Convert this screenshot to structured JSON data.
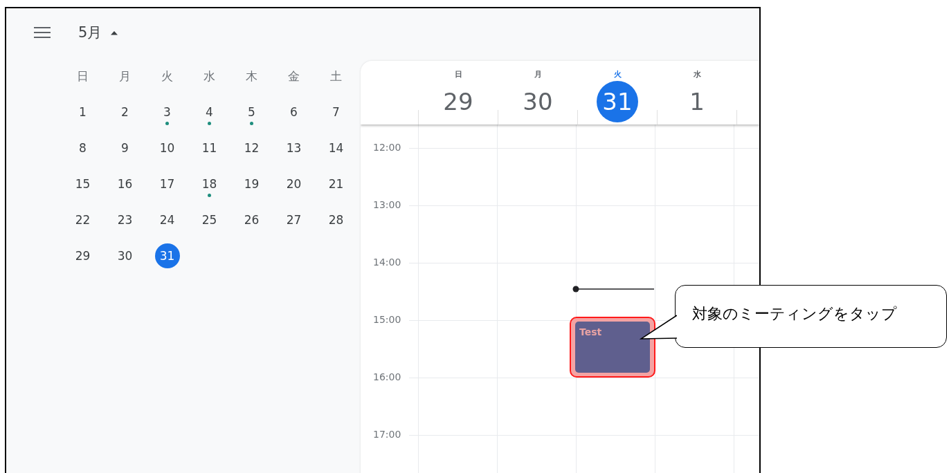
{
  "header": {
    "month": "5月"
  },
  "mini_calendar": {
    "weekdays": [
      "日",
      "月",
      "火",
      "水",
      "木",
      "金",
      "土"
    ],
    "weeks": [
      [
        {
          "day": "1",
          "dot": false,
          "selected": false
        },
        {
          "day": "2",
          "dot": false,
          "selected": false
        },
        {
          "day": "3",
          "dot": true,
          "selected": false
        },
        {
          "day": "4",
          "dot": true,
          "selected": false
        },
        {
          "day": "5",
          "dot": true,
          "selected": false
        },
        {
          "day": "6",
          "dot": false,
          "selected": false
        },
        {
          "day": "7",
          "dot": false,
          "selected": false
        }
      ],
      [
        {
          "day": "8",
          "dot": false,
          "selected": false
        },
        {
          "day": "9",
          "dot": false,
          "selected": false
        },
        {
          "day": "10",
          "dot": false,
          "selected": false
        },
        {
          "day": "11",
          "dot": false,
          "selected": false
        },
        {
          "day": "12",
          "dot": false,
          "selected": false
        },
        {
          "day": "13",
          "dot": false,
          "selected": false
        },
        {
          "day": "14",
          "dot": false,
          "selected": false
        }
      ],
      [
        {
          "day": "15",
          "dot": false,
          "selected": false
        },
        {
          "day": "16",
          "dot": false,
          "selected": false
        },
        {
          "day": "17",
          "dot": false,
          "selected": false
        },
        {
          "day": "18",
          "dot": true,
          "selected": false
        },
        {
          "day": "19",
          "dot": false,
          "selected": false
        },
        {
          "day": "20",
          "dot": false,
          "selected": false
        },
        {
          "day": "21",
          "dot": false,
          "selected": false
        }
      ],
      [
        {
          "day": "22",
          "dot": false,
          "selected": false
        },
        {
          "day": "23",
          "dot": false,
          "selected": false
        },
        {
          "day": "24",
          "dot": false,
          "selected": false
        },
        {
          "day": "25",
          "dot": false,
          "selected": false
        },
        {
          "day": "26",
          "dot": false,
          "selected": false
        },
        {
          "day": "27",
          "dot": false,
          "selected": false
        },
        {
          "day": "28",
          "dot": false,
          "selected": false
        }
      ],
      [
        {
          "day": "29",
          "dot": false,
          "selected": false
        },
        {
          "day": "30",
          "dot": false,
          "selected": false
        },
        {
          "day": "31",
          "dot": false,
          "selected": true
        }
      ]
    ]
  },
  "week_view": {
    "days": [
      {
        "weekday": "日",
        "date": "29",
        "selected": false
      },
      {
        "weekday": "月",
        "date": "30",
        "selected": false
      },
      {
        "weekday": "火",
        "date": "31",
        "selected": true
      },
      {
        "weekday": "水",
        "date": "1",
        "selected": false
      }
    ],
    "times": [
      "12:00",
      "13:00",
      "14:00",
      "15:00",
      "16:00",
      "17:00"
    ],
    "event": {
      "title": "Test",
      "color": "#5f5f8e",
      "highlighted": true
    }
  },
  "callout": {
    "text": "対象のミーティングをタップ"
  }
}
